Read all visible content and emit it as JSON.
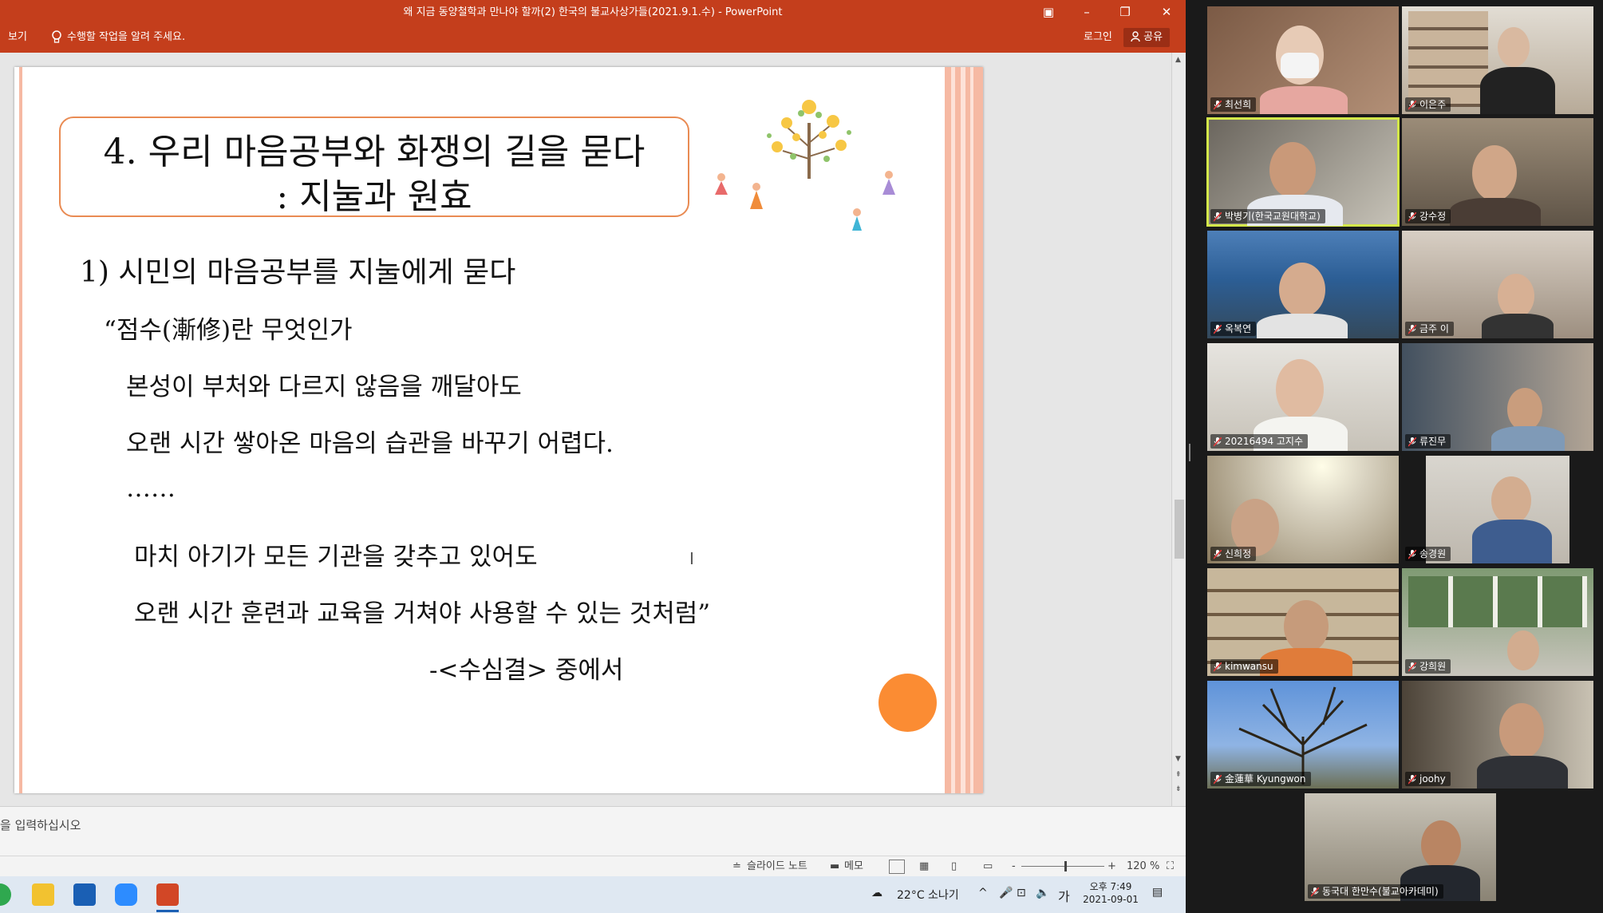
{
  "window": {
    "title": "왜 지금 동양철학과 만나야 할까(2) 한국의 불교사상가들(2021.9.1.수) - PowerPoint",
    "buttons": [
      "▣",
      "–",
      "❐",
      "✕"
    ]
  },
  "ribbon": {
    "view_tab": "보기",
    "tell_me": "수행할 작업을 알려 주세요.",
    "sign_in": "로그인",
    "share": "공유"
  },
  "slide": {
    "title_line1": "4. 우리 마음공부와 화쟁의 길을 묻다",
    "title_line2": ": 지눌과 원효",
    "subheading": "1) 시민의 마음공부를 지눌에게 묻다",
    "lines": [
      "“점수(漸修)란 무엇인가",
      "본성이 부처와 다르지 않음을 깨달아도",
      "오랜 시간 쌓아온 마음의 습관을 바꾸기 어렵다.",
      "……",
      "마치 아기가 모든 기관을 갖추고 있어도",
      "오랜 시간 훈련과 교육을 거쳐야 사용할 수 있는 것처럼”",
      "-<수심결> 중에서"
    ],
    "colors": {
      "accent_border": "#e98b53",
      "stripe": "#f6b9a3",
      "dot": "#fb8c33"
    }
  },
  "notes": {
    "placeholder": "을 입력하십시오"
  },
  "statusbar": {
    "notes_button": "슬라이드 노트",
    "comments_button": "메모",
    "zoom_minus": "-",
    "zoom_plus": "+",
    "zoom_level": "120 %"
  },
  "taskbar": {
    "weather": "22°C  소나기",
    "ime": "가",
    "time": "오후 7:49",
    "date": "2021-09-01"
  },
  "participants": [
    {
      "name": "최선희"
    },
    {
      "name": "이은주"
    },
    {
      "name": "박병기(한국교원대학교)"
    },
    {
      "name": "강수정"
    },
    {
      "name": "옥복연"
    },
    {
      "name": "금주 이"
    },
    {
      "name": "20216494 고지수"
    },
    {
      "name": "류진무"
    },
    {
      "name": "신희정"
    },
    {
      "name": "송경원"
    },
    {
      "name": "kimwansu"
    },
    {
      "name": "강희원"
    },
    {
      "name": "金蓮華 Kyungwon"
    },
    {
      "name": "joohy"
    },
    {
      "name": "동국대 한만수(불교아카데미)"
    }
  ]
}
